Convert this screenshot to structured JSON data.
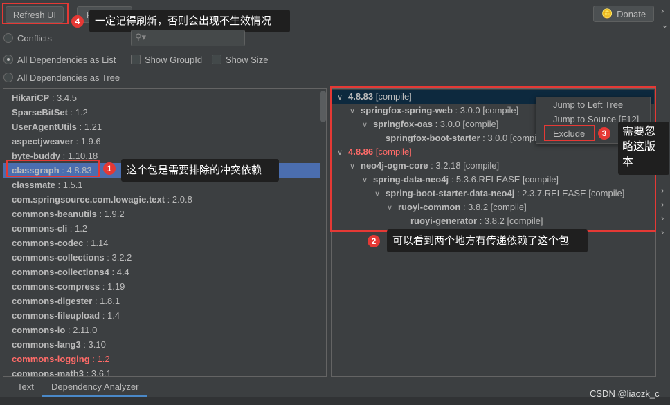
{
  "toolbar": {
    "refresh": "Refresh UI",
    "reimport": "Reimport",
    "donate": "Donate",
    "search_placeholder": ""
  },
  "options": {
    "conflicts": "Conflicts",
    "list": "All Dependencies as List",
    "tree": "All Dependencies as Tree",
    "show_groupid": "Show GroupId",
    "show_size": "Show Size",
    "selected": "All Dependencies as List"
  },
  "left_list": [
    {
      "name": "HikariCP",
      "version": " : 3.4.5"
    },
    {
      "name": "SparseBitSet",
      "version": " : 1.2"
    },
    {
      "name": "UserAgentUtils",
      "version": " : 1.21"
    },
    {
      "name": "aspectjweaver",
      "version": " : 1.9.6"
    },
    {
      "name": "byte-buddy",
      "version": " : 1.10.18"
    },
    {
      "name": "classgraph",
      "version": " : 4.8.83",
      "selected": true
    },
    {
      "name": "classmate",
      "version": " : 1.5.1"
    },
    {
      "name": "com.springsource.com.lowagie.text",
      "version": " : 2.0.8"
    },
    {
      "name": "commons-beanutils",
      "version": " : 1.9.2"
    },
    {
      "name": "commons-cli",
      "version": " : 1.2"
    },
    {
      "name": "commons-codec",
      "version": " : 1.14"
    },
    {
      "name": "commons-collections",
      "version": " : 3.2.2"
    },
    {
      "name": "commons-collections4",
      "version": " : 4.4"
    },
    {
      "name": "commons-compress",
      "version": " : 1.19"
    },
    {
      "name": "commons-digester",
      "version": " : 1.8.1"
    },
    {
      "name": "commons-fileupload",
      "version": " : 1.4"
    },
    {
      "name": "commons-io",
      "version": " : 2.11.0"
    },
    {
      "name": "commons-lang3",
      "version": " : 3.10"
    },
    {
      "name": "commons-logging",
      "version": " : 1.2",
      "conflict": true
    },
    {
      "name": "commons-math3",
      "version": " : 3.6.1"
    }
  ],
  "right_tree": [
    {
      "level": 0,
      "name": "4.8.83",
      "version": " [compile]",
      "expanded": true,
      "selected": true
    },
    {
      "level": 1,
      "name": "springfox-spring-web",
      "version": " : 3.0.0 [compile]",
      "expanded": true
    },
    {
      "level": 2,
      "name": "springfox-oas",
      "version": " : 3.0.0 [compile]",
      "expanded": true
    },
    {
      "level": 3,
      "name": "springfox-boot-starter",
      "version": " : 3.0.0 [compile]"
    },
    {
      "level": 0,
      "name": "4.8.86",
      "version": " [compile]",
      "expanded": true,
      "conflict": true
    },
    {
      "level": 1,
      "name": "neo4j-ogm-core",
      "version": " : 3.2.18 [compile]",
      "expanded": true
    },
    {
      "level": 2,
      "name": "spring-data-neo4j",
      "version": " : 5.3.6.RELEASE [compile]",
      "expanded": true
    },
    {
      "level": 3,
      "name": "spring-boot-starter-data-neo4j",
      "version": " : 2.3.7.RELEASE [compile]",
      "expanded": true
    },
    {
      "level": 4,
      "name": "ruoyi-common",
      "version": " : 3.8.2 [compile]",
      "expanded": true
    },
    {
      "level": 5,
      "name": "ruoyi-generator",
      "version": " : 3.8.2 [compile]"
    }
  ],
  "context_menu": [
    "Jump to Left Tree",
    "Jump to Source [F12]",
    "Exclude"
  ],
  "annotations": [
    {
      "num": "1",
      "text": "这个包是需要排除的冲突依赖"
    },
    {
      "num": "2",
      "text": "可以看到两个地方有传递依赖了这个包"
    },
    {
      "num": "3",
      "text": "需要忽略这版本"
    },
    {
      "num": "4",
      "text": "一定记得刷新，否则会出现不生效情况"
    }
  ],
  "tabs": [
    {
      "label": "Text"
    },
    {
      "label": "Dependency Analyzer",
      "active": true
    }
  ],
  "watermark": "CSDN @liaozk_c",
  "colors": {
    "accent": "#4b6eaf",
    "conflict": "#ff6b68",
    "annotation": "#e53935"
  }
}
